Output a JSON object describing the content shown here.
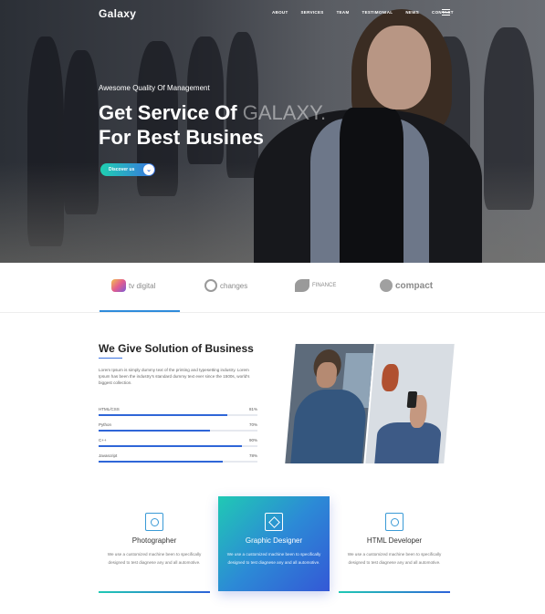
{
  "header": {
    "logo": "Galaxy",
    "nav": [
      "ABOUT",
      "SERVICES",
      "TEAM",
      "TESTIMONIAL",
      "NEWS",
      "CONTACT"
    ],
    "menu_icon": "hamburger-icon"
  },
  "hero": {
    "kicker": "Awesome Quality Of Management",
    "title_line1": "Get Service Of ",
    "title_brand": "GALAXY.",
    "title_line2": "For Best Busines",
    "button_label": "Discover us",
    "button_icon": "chevron-down-icon"
  },
  "brands": [
    {
      "name": "tv digital",
      "color": "#e35d8e"
    },
    {
      "name": "changes",
      "color": "#9a9a9a"
    },
    {
      "name": "FINANCE",
      "color": "#9a9a9a"
    },
    {
      "name": "compact",
      "color": "#9a9a9a"
    }
  ],
  "solution": {
    "title": "We Give Solution of Business",
    "text": "Lorem Ipsum is simply dummy text of the printing and typesetting industry. Lorem Ipsum has been the industry's standard dummy text ever since the 1500s, world's biggest collection.",
    "skills": [
      {
        "label": "HTML/CSS",
        "value": 81
      },
      {
        "label": "Python",
        "value": 70
      },
      {
        "label": "C++",
        "value": 90
      },
      {
        "label": "Javascript",
        "value": 78
      }
    ],
    "skill_values_text": [
      "81%",
      "70%",
      "90%",
      "78%"
    ]
  },
  "services": [
    {
      "title": "Photographer",
      "desc": "We use a customized machine been to specifically designed to test diagnese any and all automotive.",
      "icon": "photo-frame-icon"
    },
    {
      "title": "Graphic Designer",
      "desc": "We use a customized machine been to specifically designed to test diagnese any and all automotive.",
      "icon": "design-tools-icon"
    },
    {
      "title": "HTML Developer",
      "desc": "We use a customized machine been to specifically designed to test diagnese any and all automotive.",
      "icon": "code-window-icon"
    }
  ],
  "colors": {
    "accent": "#2f66d8",
    "teal": "#20c9b4"
  }
}
